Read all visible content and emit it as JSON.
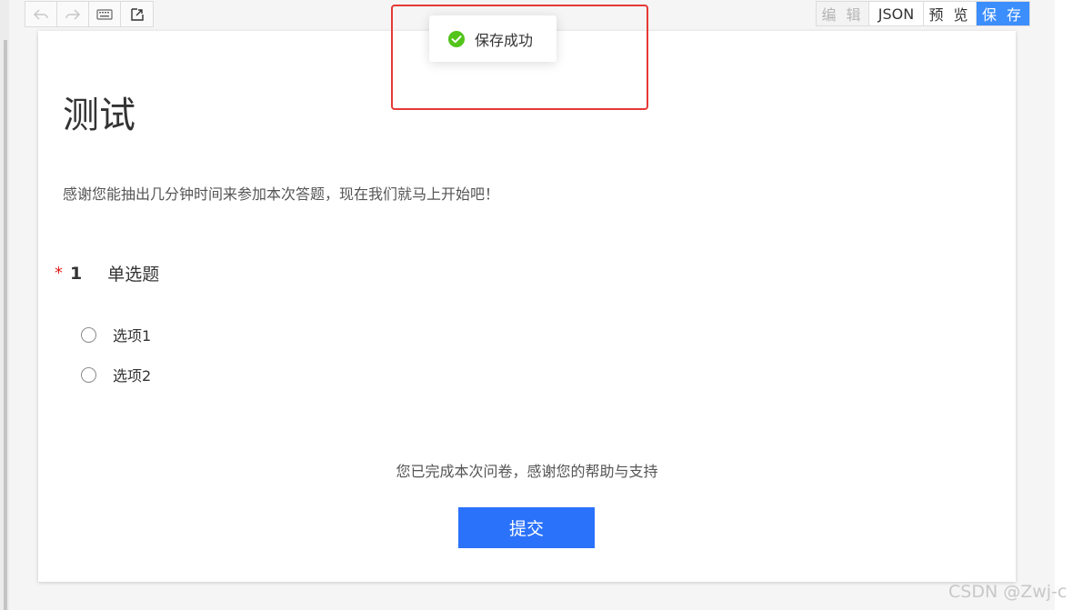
{
  "toolbar": {
    "undo_icon": "undo-icon",
    "redo_icon": "redo-icon",
    "keyboard_icon": "keyboard-icon",
    "import_icon": "import-icon",
    "edit_label": "编 辑",
    "json_label": "JSON",
    "preview_label": "预 览",
    "save_label": "保 存"
  },
  "toast": {
    "message": "保存成功",
    "icon": "success-check-icon",
    "color": "#52c41a"
  },
  "survey": {
    "title": "测试",
    "description": "感谢您能抽出几分钟时间来参加本次答题，现在我们就马上开始吧！",
    "question": {
      "required_mark": "*",
      "number": "1",
      "title": "单选题",
      "options": [
        {
          "label": "选项1"
        },
        {
          "label": "选项2"
        }
      ]
    },
    "end_text": "您已完成本次问卷，感谢您的帮助与支持",
    "submit_label": "提交"
  },
  "colors": {
    "accent": "#3c8efd",
    "submit": "#2b72fb",
    "required": "#e02020",
    "highlight": "#e53935"
  },
  "watermark": "CSDN @Zwj-c"
}
